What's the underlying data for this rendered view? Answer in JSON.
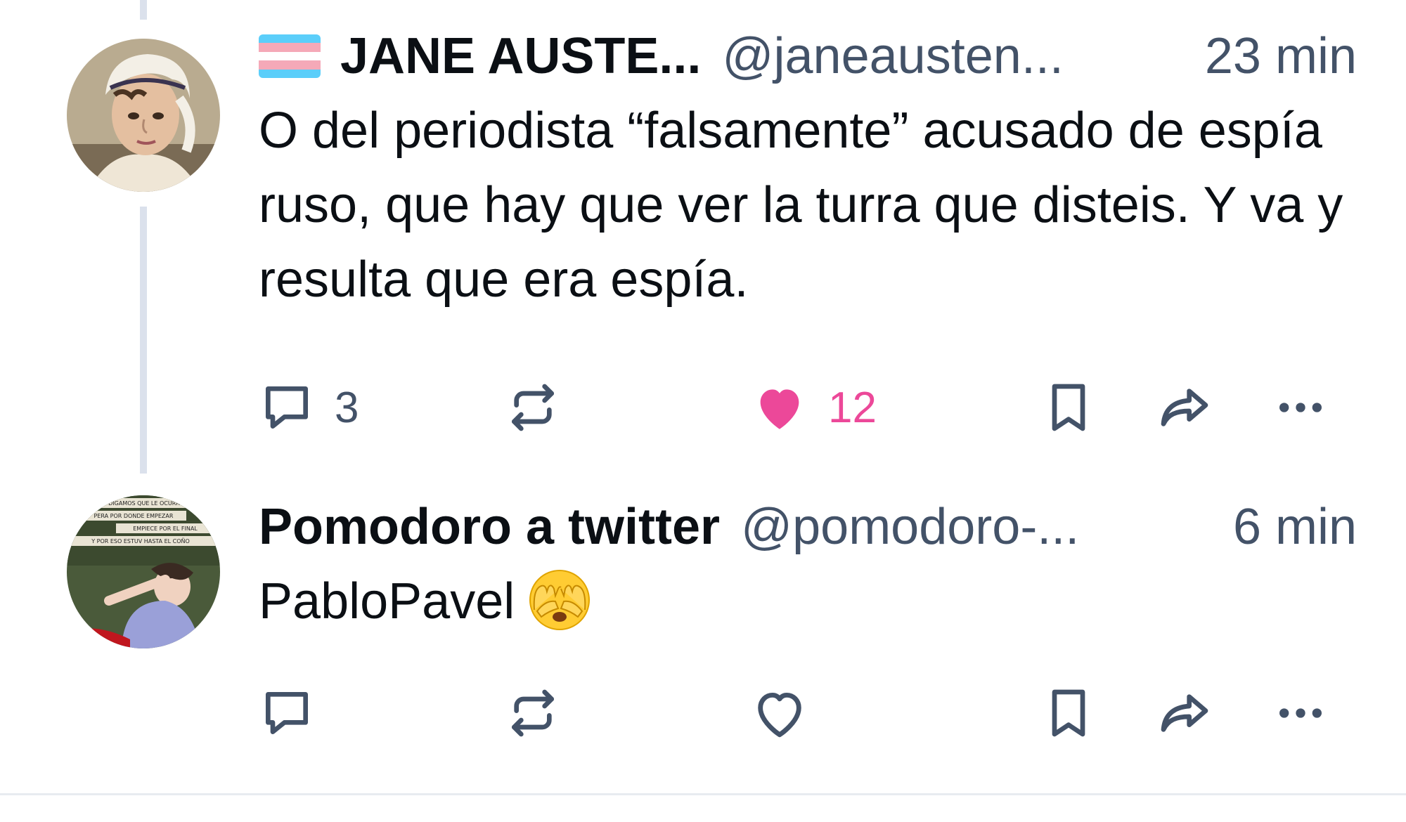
{
  "posts": [
    {
      "display_name": "JANE AUSTE...",
      "handle": "@janeausten...",
      "timestamp": "23 min",
      "name_flag_icon": "transgender-flag-icon",
      "text": "O del periodista “falsamente” acusado de espía ruso, que hay que ver la turra que disteis. Y va y resulta que era espía.",
      "actions": {
        "reply_count": "3",
        "repost_count": "",
        "like_count": "12",
        "liked": true
      }
    },
    {
      "display_name": "Pomodoro a twitter",
      "handle": "@pomodoro-...",
      "timestamp": "6 min",
      "text": "PabloPavel",
      "emoji": "face-with-hand-over-eyes-emoji",
      "avatar_caption_lines": [
        "DIGAMOS QUE LE OCURR",
        "PERA POR DONDE EMPEZAR",
        "EMPIECE POR EL FINAL",
        "Y POR ESO ESTUV HASTA EL COÑO"
      ],
      "actions": {
        "reply_count": "",
        "repost_count": "",
        "like_count": "",
        "liked": false
      }
    }
  ],
  "colors": {
    "text_primary": "#0b0f14",
    "text_secondary": "#435268",
    "icon": "#435268",
    "like_active": "#ec4899",
    "thread_line": "#dbe1ec",
    "divider": "#e8ebf0"
  }
}
